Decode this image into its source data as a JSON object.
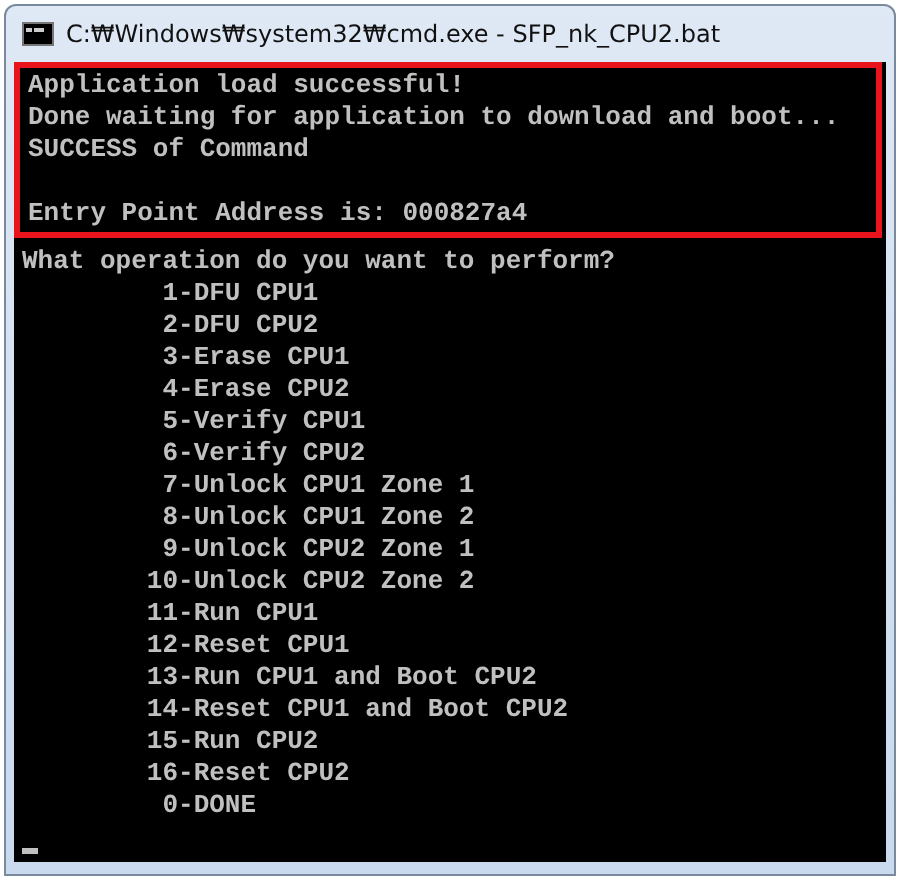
{
  "window": {
    "title": "C:₩Windows₩system32₩cmd.exe - SFP_nk_CPU2.bat"
  },
  "console": {
    "highlighted_paragraphs": [
      [
        "Application load successful!",
        "Done waiting for application to download and boot...",
        "SUCCESS of Command"
      ],
      [
        "Entry Point Address is: 000827a4"
      ]
    ],
    "lines": [
      "What operation do you want to perform?",
      "         1-DFU CPU1",
      "         2-DFU CPU2",
      "         3-Erase CPU1",
      "         4-Erase CPU2",
      "         5-Verify CPU1",
      "         6-Verify CPU2",
      "         7-Unlock CPU1 Zone 1",
      "         8-Unlock CPU1 Zone 2",
      "         9-Unlock CPU2 Zone 1",
      "        10-Unlock CPU2 Zone 2",
      "        11-Run CPU1",
      "        12-Reset CPU1",
      "        13-Run CPU1 and Boot CPU2",
      "        14-Reset CPU1 and Boot CPU2",
      "        15-Run CPU2",
      "        16-Reset CPU2",
      "         0-DONE"
    ]
  }
}
